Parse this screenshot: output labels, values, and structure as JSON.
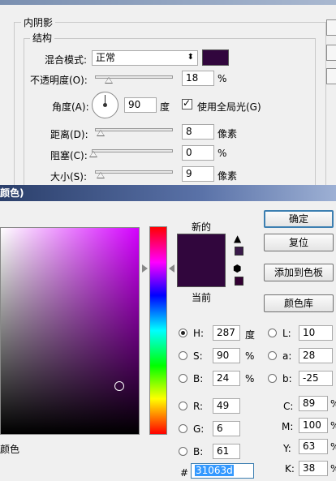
{
  "inner_shadow": {
    "section_title": "内阴影",
    "structure_title": "结构",
    "blend_mode_label": "混合模式:",
    "blend_mode_value": "正常",
    "shadow_color": "#31063d",
    "opacity_label": "不透明度(O):",
    "opacity_value": "18",
    "opacity_unit": "%",
    "angle_label": "角度(A):",
    "angle_value": "90",
    "angle_unit": "度",
    "global_light_label": "使用全局光(G)",
    "global_light_checked": true,
    "distance_label": "距离(D):",
    "distance_value": "8",
    "distance_unit": "像素",
    "choke_label": "阻塞(C):",
    "choke_value": "0",
    "choke_unit": "%",
    "size_label": "大小(S):",
    "size_value": "9",
    "size_unit": "像素"
  },
  "color_picker": {
    "title": "颜色)",
    "new_label": "新的",
    "current_label": "当前",
    "new_color": "#31063d",
    "current_color": "#31063d",
    "ok_button": "确定",
    "reset_button": "复位",
    "add_swatch_button": "添加到色板",
    "color_library_button": "颜色库",
    "only_web_colors_label": "颜色",
    "hsb": {
      "h_label": "H:",
      "h_value": "287",
      "h_unit": "度",
      "s_label": "S:",
      "s_value": "90",
      "s_unit": "%",
      "b_label": "B:",
      "b_value": "24",
      "b_unit": "%"
    },
    "rgb": {
      "r_label": "R:",
      "r_value": "49",
      "g_label": "G:",
      "g_value": "6",
      "b_label": "B:",
      "b_value": "61"
    },
    "lab": {
      "l_label": "L:",
      "l_value": "10",
      "a_label": "a:",
      "a_value": "28",
      "b_label": "b:",
      "b_value": "-25"
    },
    "cmyk": {
      "c_label": "C:",
      "c_value": "89",
      "m_label": "M:",
      "m_value": "100",
      "y_label": "Y:",
      "y_value": "63",
      "k_label": "K:",
      "k_value": "38",
      "unit": "%"
    },
    "hex_label": "#",
    "hex_value": "31063d",
    "selected_mode": "H"
  }
}
